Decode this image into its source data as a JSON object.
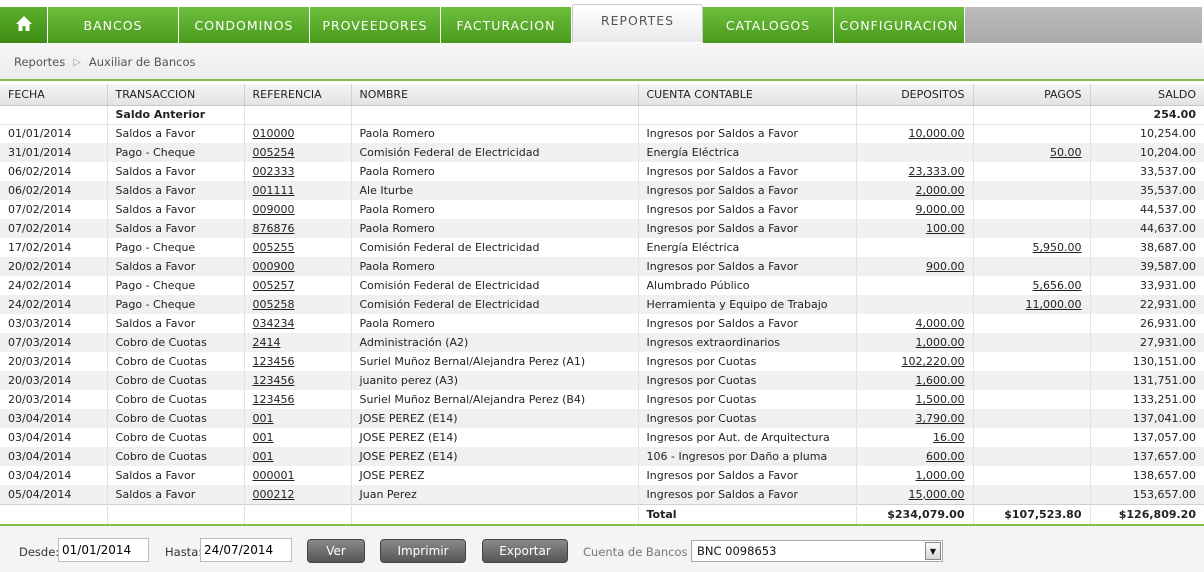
{
  "nav": {
    "home_icon": "home-icon",
    "tabs": [
      "BANCOS",
      "CONDOMINOS",
      "PROVEEDORES",
      "FACTURACION",
      "REPORTES",
      "CATALOGOS",
      "CONFIGURACION"
    ],
    "active_tab": "REPORTES",
    "accent": "#5aac2a"
  },
  "breadcrumb": {
    "root": "Reportes",
    "current": "Auxiliar de Bancos"
  },
  "table": {
    "headers": [
      "FECHA",
      "TRANSACCION",
      "REFERENCIA",
      "NOMBRE",
      "CUENTA CONTABLE",
      "DEPOSITOS",
      "PAGOS",
      "SALDO"
    ],
    "saldo_anterior": {
      "label": "Saldo Anterior",
      "saldo": "254.00"
    },
    "rows": [
      {
        "fecha": "01/01/2014",
        "transaccion": "Saldos a Favor",
        "referencia": "010000",
        "nombre": "Paola Romero",
        "cuenta": "Ingresos por Saldos a Favor",
        "depositos": "10,000.00",
        "pagos": "",
        "saldo": "10,254.00"
      },
      {
        "fecha": "31/01/2014",
        "transaccion": "Pago - Cheque",
        "referencia": "005254",
        "nombre": "Comisión Federal de Electricidad",
        "cuenta": "Energía Eléctrica",
        "depositos": "",
        "pagos": "50.00",
        "saldo": "10,204.00"
      },
      {
        "fecha": "06/02/2014",
        "transaccion": "Saldos a Favor",
        "referencia": "002333",
        "nombre": "Paola Romero",
        "cuenta": "Ingresos por Saldos a Favor",
        "depositos": "23,333.00",
        "pagos": "",
        "saldo": "33,537.00"
      },
      {
        "fecha": "06/02/2014",
        "transaccion": "Saldos a Favor",
        "referencia": "001111",
        "nombre": "Ale Iturbe",
        "cuenta": "Ingresos por Saldos a Favor",
        "depositos": "2,000.00",
        "pagos": "",
        "saldo": "35,537.00"
      },
      {
        "fecha": "07/02/2014",
        "transaccion": "Saldos a Favor",
        "referencia": "009000",
        "nombre": "Paola Romero",
        "cuenta": "Ingresos por Saldos a Favor",
        "depositos": "9,000.00",
        "pagos": "",
        "saldo": "44,537.00"
      },
      {
        "fecha": "07/02/2014",
        "transaccion": "Saldos a Favor",
        "referencia": "876876",
        "nombre": "Paola Romero",
        "cuenta": "Ingresos por Saldos a Favor",
        "depositos": "100.00",
        "pagos": "",
        "saldo": "44,637.00"
      },
      {
        "fecha": "17/02/2014",
        "transaccion": "Pago - Cheque",
        "referencia": "005255",
        "nombre": "Comisión Federal de Electricidad",
        "cuenta": "Energía Eléctrica",
        "depositos": "",
        "pagos": "5,950.00",
        "saldo": "38,687.00"
      },
      {
        "fecha": "20/02/2014",
        "transaccion": "Saldos a Favor",
        "referencia": "000900",
        "nombre": "Paola Romero",
        "cuenta": "Ingresos por Saldos a Favor",
        "depositos": "900.00",
        "pagos": "",
        "saldo": "39,587.00"
      },
      {
        "fecha": "24/02/2014",
        "transaccion": "Pago - Cheque",
        "referencia": "005257",
        "nombre": "Comisión Federal de Electricidad",
        "cuenta": "Alumbrado Público",
        "depositos": "",
        "pagos": "5,656.00",
        "saldo": "33,931.00"
      },
      {
        "fecha": "24/02/2014",
        "transaccion": "Pago - Cheque",
        "referencia": "005258",
        "nombre": "Comisión Federal de Electricidad",
        "cuenta": "Herramienta y Equipo de Trabajo",
        "depositos": "",
        "pagos": "11,000.00",
        "saldo": "22,931.00"
      },
      {
        "fecha": "03/03/2014",
        "transaccion": "Saldos a Favor",
        "referencia": "034234",
        "nombre": "Paola Romero",
        "cuenta": "Ingresos por Saldos a Favor",
        "depositos": "4,000.00",
        "pagos": "",
        "saldo": "26,931.00"
      },
      {
        "fecha": "07/03/2014",
        "transaccion": "Cobro de Cuotas",
        "referencia": "2414",
        "nombre": "Administración (A2)",
        "cuenta": "Ingresos extraordinarios",
        "depositos": "1,000.00",
        "pagos": "",
        "saldo": "27,931.00"
      },
      {
        "fecha": "20/03/2014",
        "transaccion": "Cobro de Cuotas",
        "referencia": "123456",
        "nombre": "Suriel Muñoz Bernal/Alejandra Perez (A1)",
        "cuenta": "Ingresos por Cuotas",
        "depositos": "102,220.00",
        "pagos": "",
        "saldo": "130,151.00"
      },
      {
        "fecha": "20/03/2014",
        "transaccion": "Cobro de Cuotas",
        "referencia": "123456",
        "nombre": "juanito perez (A3)",
        "cuenta": "Ingresos por Cuotas",
        "depositos": "1,600.00",
        "pagos": "",
        "saldo": "131,751.00"
      },
      {
        "fecha": "20/03/2014",
        "transaccion": "Cobro de Cuotas",
        "referencia": "123456",
        "nombre": "Suriel Muñoz Bernal/Alejandra Perez (B4)",
        "cuenta": "Ingresos por Cuotas",
        "depositos": "1,500.00",
        "pagos": "",
        "saldo": "133,251.00"
      },
      {
        "fecha": "03/04/2014",
        "transaccion": "Cobro de Cuotas",
        "referencia": "001",
        "nombre": "JOSE PEREZ (E14)",
        "cuenta": "Ingresos por Cuotas",
        "depositos": "3,790.00",
        "pagos": "",
        "saldo": "137,041.00"
      },
      {
        "fecha": "03/04/2014",
        "transaccion": "Cobro de Cuotas",
        "referencia": "001",
        "nombre": "JOSE PEREZ (E14)",
        "cuenta": "Ingresos por Aut. de Arquitectura",
        "depositos": "16.00",
        "pagos": "",
        "saldo": "137,057.00"
      },
      {
        "fecha": "03/04/2014",
        "transaccion": "Cobro de Cuotas",
        "referencia": "001",
        "nombre": "JOSE PEREZ (E14)",
        "cuenta": "106 - Ingresos por Daño a pluma",
        "depositos": "600.00",
        "pagos": "",
        "saldo": "137,657.00"
      },
      {
        "fecha": "03/04/2014",
        "transaccion": "Saldos a Favor",
        "referencia": "000001",
        "nombre": "JOSE PEREZ",
        "cuenta": "Ingresos por Saldos a Favor",
        "depositos": "1,000.00",
        "pagos": "",
        "saldo": "138,657.00"
      },
      {
        "fecha": "05/04/2014",
        "transaccion": "Saldos a Favor",
        "referencia": "000212",
        "nombre": "Juan Perez",
        "cuenta": "Ingresos por Saldos a Favor",
        "depositos": "15,000.00",
        "pagos": "",
        "saldo": "153,657.00"
      }
    ],
    "total": {
      "label": "Total",
      "depositos": "$234,079.00",
      "pagos": "$107,523.80",
      "saldo": "$126,809.20"
    }
  },
  "filters": {
    "desde_label": "Desde:",
    "desde_value": "01/01/2014",
    "hasta_label": "Hasta:",
    "hasta_value": "24/07/2014",
    "ver_label": "Ver",
    "imprimir_label": "Imprimir",
    "exportar_label": "Exportar",
    "cuenta_label": "Cuenta de Bancos :",
    "cuenta_value": "BNC 0098653"
  }
}
